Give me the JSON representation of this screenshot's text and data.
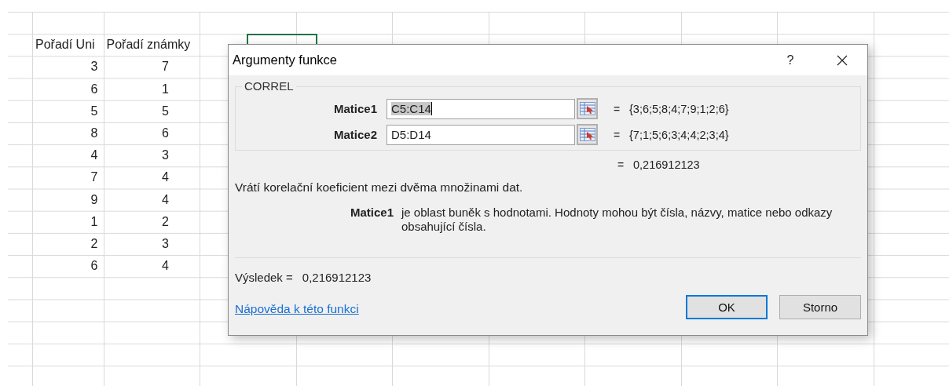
{
  "sheet": {
    "headers": [
      "Pořadí Uni",
      "Pořadí známky"
    ],
    "rows": [
      [
        "3",
        "7"
      ],
      [
        "6",
        "1"
      ],
      [
        "5",
        "5"
      ],
      [
        "8",
        "6"
      ],
      [
        "4",
        "3"
      ],
      [
        "7",
        "4"
      ],
      [
        "9",
        "4"
      ],
      [
        "1",
        "2"
      ],
      [
        "2",
        "3"
      ],
      [
        "6",
        "4"
      ]
    ]
  },
  "dialog": {
    "title": "Argumenty funkce",
    "help_button": "?",
    "function_name": "CORREL",
    "arguments": [
      {
        "label": "Matice1",
        "value": "C5:C14",
        "text_selected": true,
        "equals": "=",
        "result": "{3;6;5;8;4;7;9;1;2;6}"
      },
      {
        "label": "Matice2",
        "value": "D5:D14",
        "text_selected": false,
        "equals": "=",
        "result": "{7;1;5;6;3;4;4;2;3;4}"
      }
    ],
    "formula_equals": "=",
    "formula_result": "0,216912123",
    "description": "Vrátí korelační koeficient mezi dvěma množinami dat.",
    "argument_help": {
      "name": "Matice1",
      "text": "je oblast buněk s hodnotami. Hodnoty mohou být čísla, názvy, matice nebo odkazy obsahující čísla."
    },
    "result_label": "Výsledek =",
    "result_value": "0,216912123",
    "help_link": "Nápověda k této funkci",
    "buttons": [
      {
        "label": "OK",
        "default": true
      },
      {
        "label": "Storno",
        "default": false
      }
    ]
  }
}
